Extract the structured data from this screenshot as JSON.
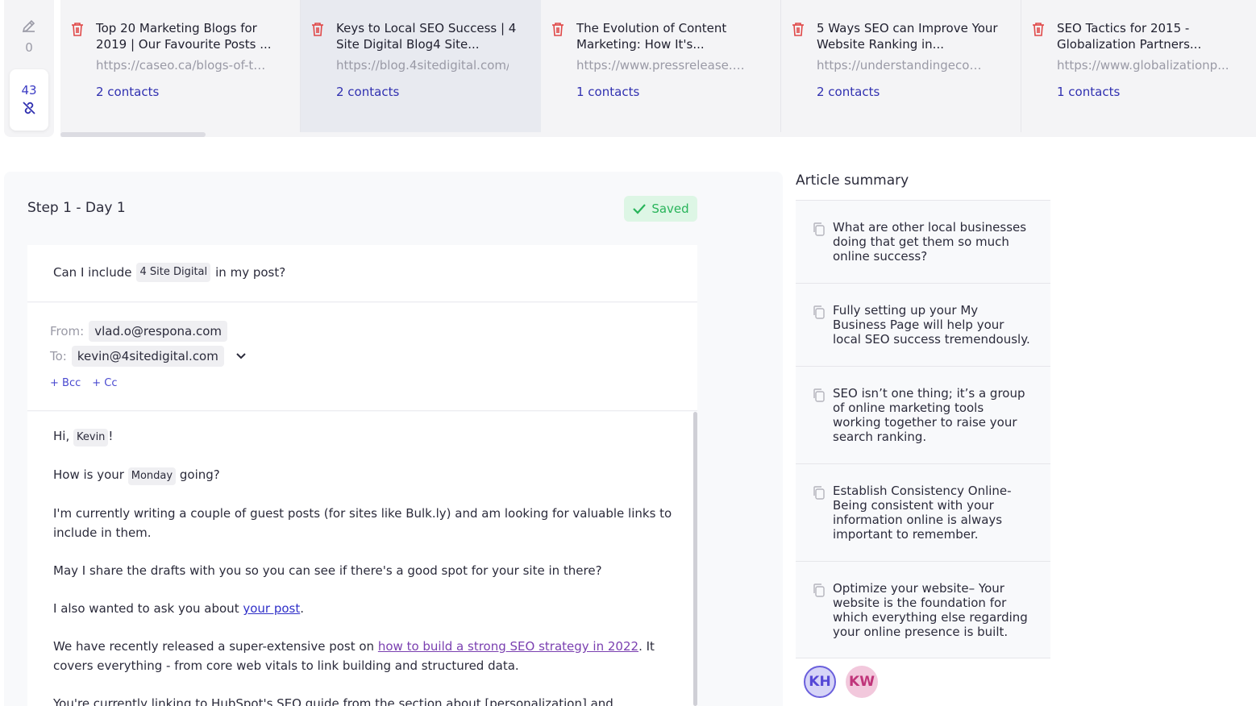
{
  "sidebar": {
    "pencil_count": "0",
    "link_count": "43"
  },
  "opportunities": [
    {
      "title": "Top 20 Marketing Blogs for 2019 | Our Favourite Posts ...",
      "url": "https://caseo.ca/blogs-of-th...",
      "contacts": "2 contacts",
      "active": false
    },
    {
      "title": "Keys to Local SEO Success | 4 Site Digital Blog4 Site...",
      "url": "https://blog.4sitedigital.com/k",
      "contacts": "2 contacts",
      "active": true
    },
    {
      "title": "The Evolution of Content Marketing: How It's...",
      "url": "https://www.pressrelease.c...",
      "contacts": "1 contacts",
      "active": false
    },
    {
      "title": "5 Ways SEO can Improve Your Website Ranking in...",
      "url": "https://understandingecom...",
      "contacts": "2 contacts",
      "active": false
    },
    {
      "title": "SEO Tactics for 2015 - Globalization Partners...",
      "url": "https://www.globalizationp...",
      "contacts": "1 contacts",
      "active": false
    }
  ],
  "step": {
    "title": "Step 1 - Day 1",
    "saved_label": "Saved"
  },
  "email": {
    "subject_before": "Can I include",
    "subject_var": "4 Site Digital",
    "subject_after": "in my post?",
    "from_label": "From:",
    "from_value": "vlad.o@respona.com",
    "to_label": "To:",
    "to_value": "kevin@4sitedigital.com",
    "bcc_label": "+ Bcc",
    "cc_label": "+ Cc",
    "greeting_before": "Hi,",
    "greeting_var": "Kevin",
    "greeting_after": "!",
    "line2_before": "How is your",
    "line2_var": "Monday",
    "line2_after": "going?",
    "para3": "I'm currently writing a couple of guest posts (for sites like Bulk.ly) and am looking for valuable links to include in them.",
    "para4": "May I share the drafts with you so you can see if there's a good spot for your site in there?",
    "para5_before": "I also wanted to ask you about",
    "para5_link": "your post",
    "para5_after": ".",
    "para6_before": "We have recently released a super-extensive post on",
    "para6_link": "how to build a strong SEO strategy in 2022",
    "para6_after": ". It covers everything - from core web vitals to link building and structured data.",
    "para7": "You're currently linking to HubSpot's SEO guide from the section about [personalization] and"
  },
  "summary": {
    "title": "Article summary",
    "items": [
      "What are other local businesses doing that get them so much online success?",
      "Fully setting up your My Business Page will help your local SEO success tremendously.",
      "SEO isn’t one thing; it’s a group of online marketing tools working together to raise your search ranking.",
      "Establish Consistency Online- Being consistent with your information online is always important to remember.",
      "Optimize your website– Your website is the foundation for which everything else regarding your online presence is built."
    ]
  },
  "avatars": [
    {
      "initials": "KH",
      "color": "#5548d6"
    },
    {
      "initials": "KW",
      "color": "#c0357a"
    }
  ]
}
